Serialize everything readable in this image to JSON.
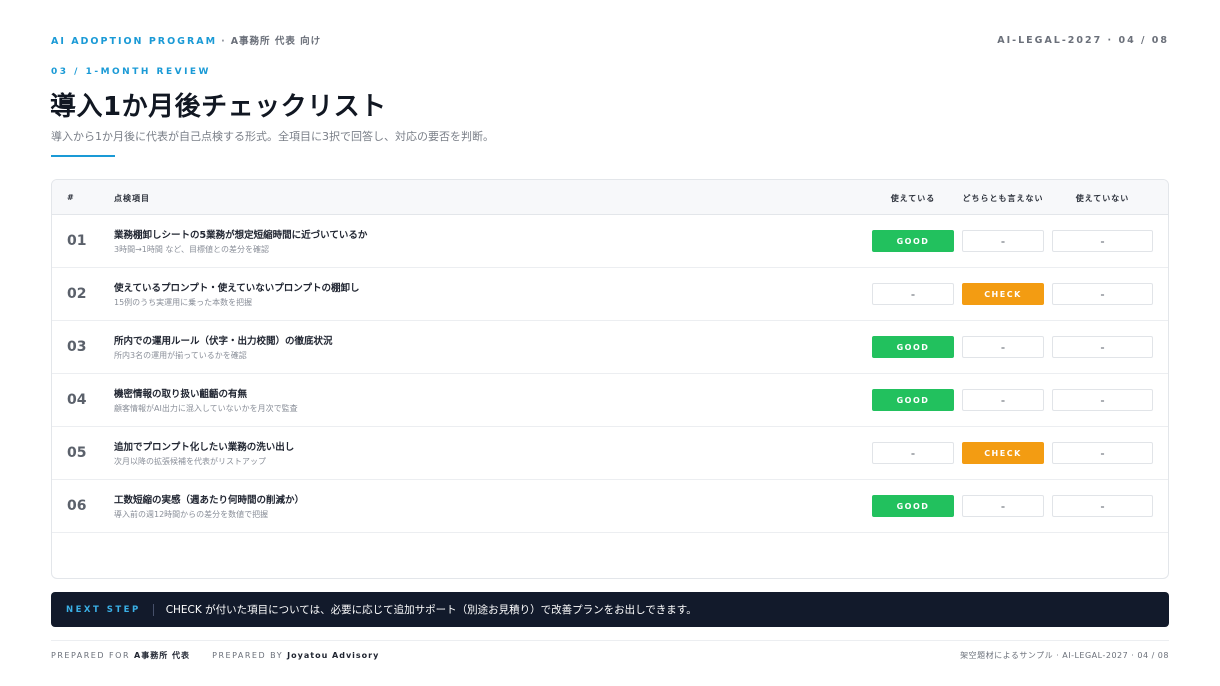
{
  "header": {
    "program": "AI ADOPTION PROGRAM",
    "separator": "·",
    "client": "A事務所 代表 向け",
    "page_ref": "AI-LEGAL-2027 · 04 / 08"
  },
  "section": {
    "label": "03 / 1-MONTH REVIEW",
    "title": "導入1か月後チェックリスト",
    "subtitle": "導入から1か月後に代表が自己点検する形式。全項目に3択で回答し、対応の要否を判断。"
  },
  "table": {
    "columns": {
      "num": "#",
      "item": "点検項目",
      "c1": "使えている",
      "c2": "どちらとも言えない",
      "c3": "使えていない"
    },
    "rows": [
      {
        "num": "01",
        "title": "業務棚卸しシートの5業務が想定短縮時間に近づいているか",
        "sub": "3時間→1時間 など、目標値との差分を確認",
        "c1": "GOOD",
        "c2": "–",
        "c3": "–"
      },
      {
        "num": "02",
        "title": "使えているプロンプト・使えていないプロンプトの棚卸し",
        "sub": "15例のうち実運用に乗った本数を把握",
        "c1": "–",
        "c2": "CHECK",
        "c3": "–"
      },
      {
        "num": "03",
        "title": "所内での運用ルール（伏字・出力校閲）の徹底状況",
        "sub": "所内3名の運用が揃っているかを確認",
        "c1": "GOOD",
        "c2": "–",
        "c3": "–"
      },
      {
        "num": "04",
        "title": "機密情報の取り扱い齟齬の有無",
        "sub": "顧客情報がAI出力に混入していないかを月次で監査",
        "c1": "GOOD",
        "c2": "–",
        "c3": "–"
      },
      {
        "num": "05",
        "title": "追加でプロンプト化したい業務の洗い出し",
        "sub": "次月以降の拡張候補を代表がリストアップ",
        "c1": "–",
        "c2": "CHECK",
        "c3": "–"
      },
      {
        "num": "06",
        "title": "工数短縮の実感（週あたり何時間の削減か）",
        "sub": "導入前の週12時間からの差分を数値で把握",
        "c1": "GOOD",
        "c2": "–",
        "c3": "–"
      }
    ]
  },
  "next_step": {
    "label": "NEXT STEP",
    "message": "CHECK が付いた項目については、必要に応じて追加サポート（別途お見積り）で改善プランをお出しできます。"
  },
  "footer": {
    "prepared_for_label": "PREPARED FOR",
    "prepared_for": "A事務所 代表",
    "prepared_by_label": "PREPARED BY",
    "prepared_by": "Joyatou Advisory",
    "right": "架空題材によるサンプル · AI-LEGAL-2027 · 04 / 08"
  },
  "colors": {
    "accent": "#1a9ad6",
    "good": "#22c15e",
    "check": "#f39c12",
    "next_bar": "#121a2b"
  }
}
